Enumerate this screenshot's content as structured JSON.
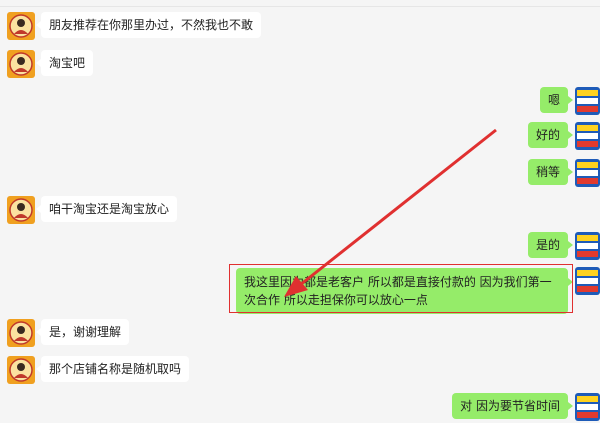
{
  "messages": [
    {
      "side": "left",
      "text": "朋友推荐在你那里办过，不然我也不敢"
    },
    {
      "side": "left",
      "text": "淘宝吧"
    },
    {
      "side": "right",
      "text": "嗯"
    },
    {
      "side": "right",
      "text": "好的"
    },
    {
      "side": "right",
      "text": "稍等"
    },
    {
      "side": "left",
      "text": "咱干淘宝还是淘宝放心"
    },
    {
      "side": "right",
      "text": "是的"
    },
    {
      "side": "right",
      "text": "我这里因为都是老客户  所以都是直接付款的   因为我们第一次合作  所以走担保你可以放心一点"
    },
    {
      "side": "left",
      "text": "是，谢谢理解"
    },
    {
      "side": "left",
      "text": "那个店铺名称是随机取吗"
    },
    {
      "side": "right",
      "text": "对  因为要节省时间"
    }
  ],
  "colors": {
    "background": "#f5f5f5",
    "incoming_bubble": "#ffffff",
    "outgoing_bubble": "#95ec69",
    "annotation_red": "#e03030"
  },
  "icons": {
    "left_avatar": "portrait-avatar-icon",
    "right_avatar": "product-card-avatar-icon"
  }
}
